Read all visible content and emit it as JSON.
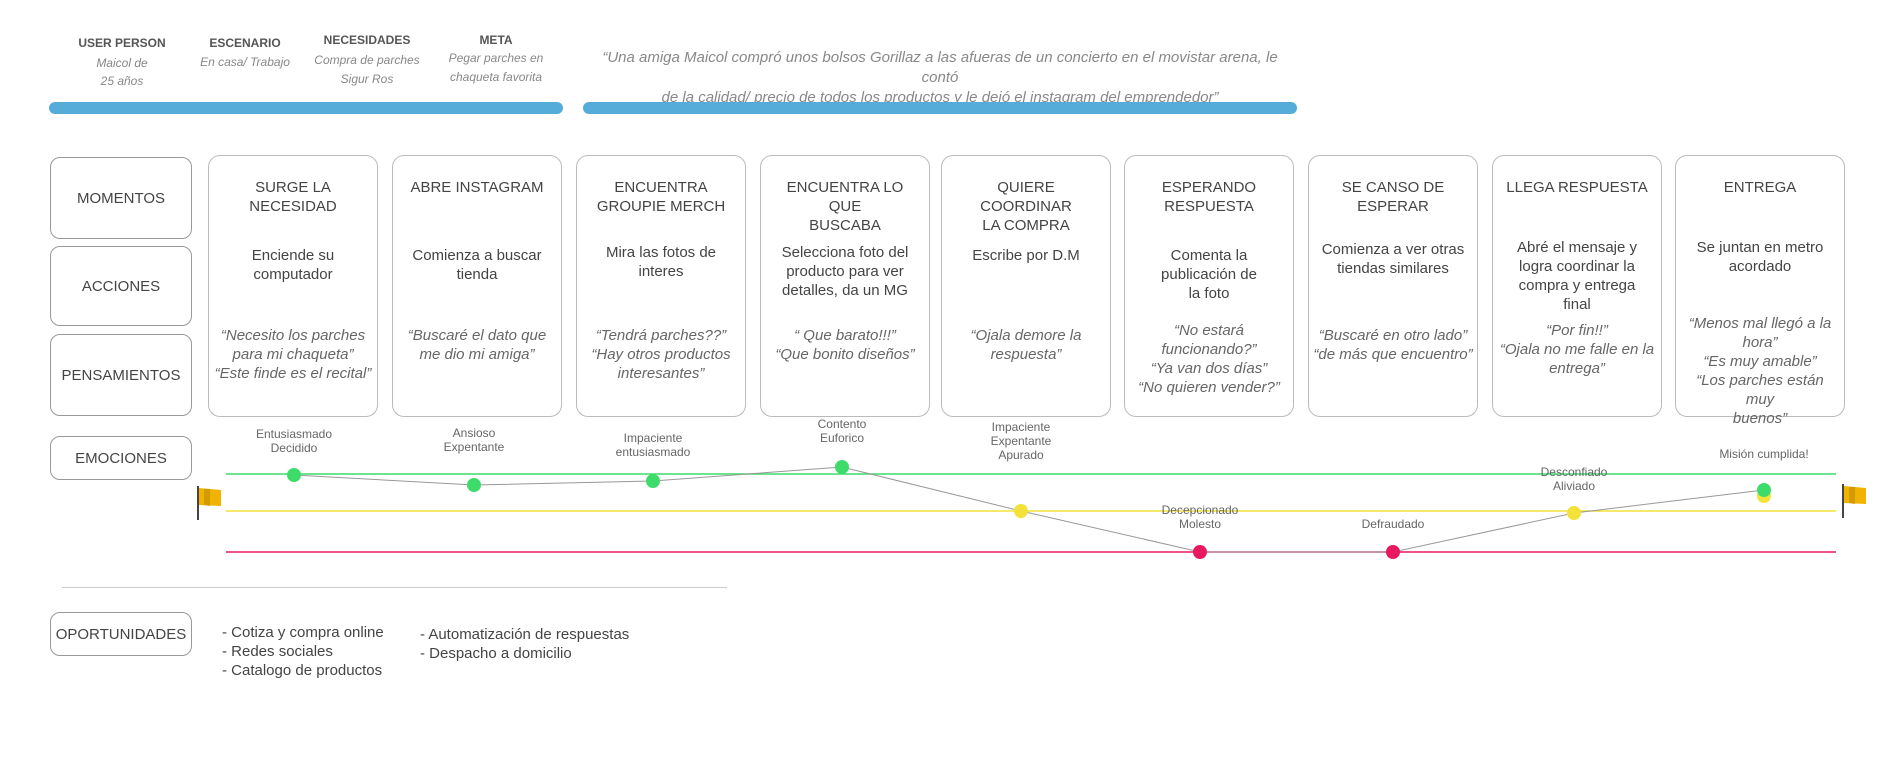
{
  "header": {
    "user": {
      "title": "USER PERSON",
      "lines": [
        "Maicol de",
        "25 años"
      ]
    },
    "scenario": {
      "title": "ESCENARIO",
      "lines": [
        "En casa/ Trabajo"
      ]
    },
    "needs": {
      "title": "NECESIDADES",
      "lines": [
        "Compra de parches",
        "Sigur Ros"
      ]
    },
    "goal": {
      "title": "META",
      "lines": [
        "Pegar parches en",
        "chaqueta favorita"
      ]
    },
    "quote_lines": [
      "“Una amiga  Maicol compró unos bolsos Gorillaz a las afueras de un concierto en el movistar arena, le contó",
      "de la calidad/ precio de todos los productos y le dejó el instagram del emprendedor”"
    ]
  },
  "row_labels": {
    "moments": "MOMENTOS",
    "actions": "ACCIONES",
    "thoughts": "PENSAMIENTOS",
    "emotions": "EMOCIONES",
    "opportunities": "OPORTUNIDADES"
  },
  "stages": [
    {
      "title": [
        "SURGE LA NECESIDAD"
      ],
      "action": [
        "Enciende su",
        "computador"
      ],
      "thought": [
        "“Necesito los parches",
        "para mi chaqueta”",
        "“Este finde es el recital”"
      ]
    },
    {
      "title": [
        "ABRE INSTAGRAM"
      ],
      "action": [
        "Comienza a buscar",
        "tienda"
      ],
      "thought": [
        "“Buscaré el dato que",
        "me dio mi amiga”"
      ]
    },
    {
      "title": [
        "ENCUENTRA",
        "GROUPIE MERCH"
      ],
      "action": [
        "Mira las fotos de",
        "interes"
      ],
      "thought": [
        "“Tendrá parches??”",
        "“Hay otros productos",
        "interesantes”"
      ]
    },
    {
      "title": [
        "ENCUENTRA LO QUE",
        "BUSCABA"
      ],
      "action": [
        "Selecciona foto del",
        "producto para ver",
        "detalles, da un MG"
      ],
      "thought": [
        "“ Que barato!!!”",
        "“Que bonito diseños”"
      ]
    },
    {
      "title": [
        "QUIERE COORDINAR",
        "LA COMPRA"
      ],
      "action": [
        "Escribe por D.M"
      ],
      "thought": [
        "“Ojala demore la",
        "respuesta”"
      ]
    },
    {
      "title": [
        "ESPERANDO",
        "RESPUESTA"
      ],
      "action": [
        "Comenta la",
        "publicación de",
        "la foto"
      ],
      "thought": [
        "“No estará funcionando?”",
        "“Ya van dos días”",
        "“No quieren vender?”"
      ]
    },
    {
      "title": [
        "SE CANSO DE",
        "ESPERAR"
      ],
      "action": [
        "Comienza a ver otras",
        "tiendas similares"
      ],
      "thought": [
        "“Buscaré en otro lado”",
        "“de más que encuentro”"
      ]
    },
    {
      "title": [
        "LLEGA RESPUESTA"
      ],
      "action": [
        "Abré el mensaje y",
        "logra coordinar la",
        "compra y entrega",
        "final"
      ],
      "thought": [
        "“Por fin!!”",
        "“Ojala no me falle en la",
        "entrega”"
      ]
    },
    {
      "title": [
        "ENTREGA"
      ],
      "action": [
        "Se juntan en metro",
        "acordado"
      ],
      "thought": [
        "“Menos mal llegó a la",
        "hora”",
        "“Es muy amable”",
        "“Los parches están muy",
        "buenos”"
      ]
    }
  ],
  "emotions": {
    "levels": {
      "high": "#3ddc6a",
      "mid": "#f2e23a",
      "low": "#e8195e"
    },
    "points": [
      {
        "level": "high",
        "label": [
          "Entusiasmado",
          "Decidido"
        ]
      },
      {
        "level": "high",
        "label": [
          "Ansioso",
          "Expentante"
        ]
      },
      {
        "level": "high",
        "label": [
          "Impaciente",
          "entusiasmado"
        ]
      },
      {
        "level": "high",
        "label": [
          "Contento",
          "Euforico"
        ]
      },
      {
        "level": "mid",
        "label": [
          "Impaciente",
          "Expentante",
          "Apurado"
        ]
      },
      {
        "level": "low",
        "label": [
          "Decepcionado",
          "Molesto"
        ]
      },
      {
        "level": "low",
        "label": [
          "Defraudado"
        ]
      },
      {
        "level": "mid",
        "label": [
          "Desconfiado",
          "Aliviado"
        ]
      },
      {
        "level": "high",
        "label": [
          "Misión cumplida!"
        ]
      }
    ],
    "flag_color": "#f0b400"
  },
  "opportunities": {
    "col1": [
      "- Cotiza y compra online",
      "- Redes sociales",
      "- Catalogo de productos"
    ],
    "col2": [
      "- Automatización de respuestas",
      "- Despacho a domicilio"
    ]
  }
}
